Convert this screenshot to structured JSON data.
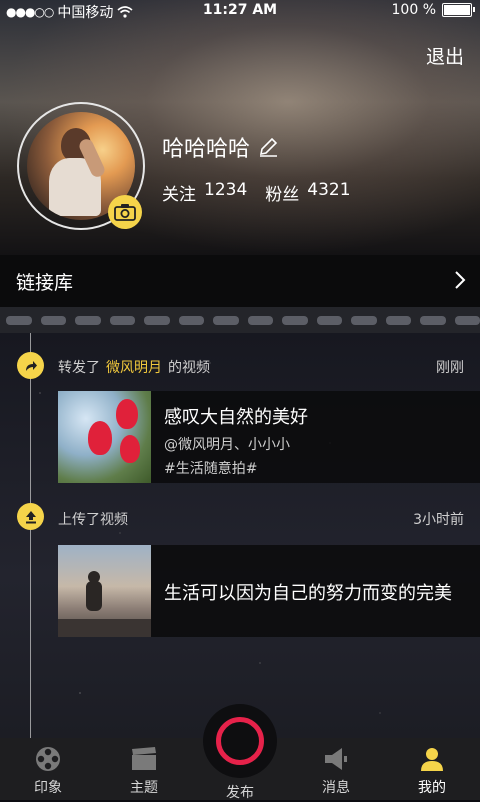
{
  "status_bar": {
    "signal": "●●●○○",
    "carrier": "中国移动",
    "time": "11:27 AM",
    "battery": "100 %"
  },
  "header": {
    "logout_label": "退出"
  },
  "profile": {
    "username": "哈哈哈哈",
    "following_label": "关注",
    "following_count": "1234",
    "followers_label": "粉丝",
    "followers_count": "4321"
  },
  "link_library": {
    "label": "链接库"
  },
  "feed": [
    {
      "icon": "share-arrow-icon",
      "action_prefix": "转发了",
      "highlight": "微风明月",
      "action_suffix": "的视频",
      "time": "刚刚",
      "title": "感叹大自然的美好",
      "mention": "@微风明月、小小小",
      "tag": "#生活随意拍#"
    },
    {
      "icon": "upload-icon",
      "action_prefix": "上传了视频",
      "time": "3小时前",
      "title": "生活可以因为自己的努力而变的完美"
    }
  ],
  "tabbar": {
    "items": [
      {
        "label": "印象",
        "icon": "film-reel-icon"
      },
      {
        "label": "主题",
        "icon": "clapperboard-icon"
      },
      {
        "label": "发布",
        "icon": "record-icon"
      },
      {
        "label": "消息",
        "icon": "megaphone-icon"
      },
      {
        "label": "我的",
        "icon": "person-icon"
      }
    ],
    "active": "我的"
  },
  "colors": {
    "accent_yellow": "#f5d44a",
    "highlight_text": "#f0c83c",
    "record_red": "#e6224a"
  }
}
